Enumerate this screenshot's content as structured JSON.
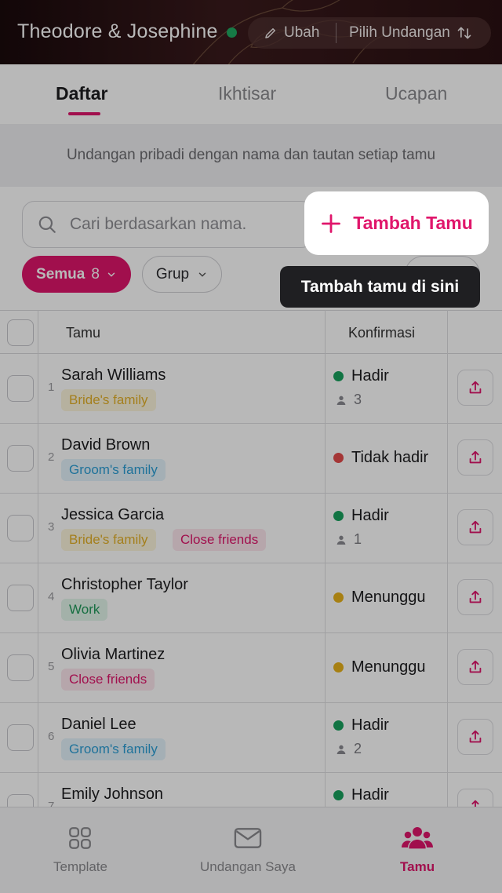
{
  "header": {
    "couple_name": "Theodore & Josephine",
    "edit_label": "Ubah",
    "choose_label": "Pilih Undangan"
  },
  "tabs": [
    {
      "label": "Daftar",
      "active": true
    },
    {
      "label": "Ikhtisar",
      "active": false
    },
    {
      "label": "Ucapan",
      "active": false
    }
  ],
  "info_text": "Undangan pribadi dengan nama dan tautan setiap tamu",
  "search": {
    "placeholder": "Cari berdasarkan nama."
  },
  "add_button": {
    "label": "Tambah Tamu"
  },
  "tooltip": "Tambah tamu di sini",
  "filters": {
    "all_label": "Semua",
    "all_count": "8",
    "group_label": "Grup"
  },
  "table": {
    "headers": {
      "guest": "Tamu",
      "confirm": "Konfirmasi"
    },
    "rows": [
      {
        "num": "1",
        "name": "Sarah Williams",
        "tags": [
          "Bride's family"
        ],
        "status": "Hadir",
        "status_color": "#18a15e",
        "people": "3"
      },
      {
        "num": "2",
        "name": "David Brown",
        "tags": [
          "Groom's family"
        ],
        "status": "Tidak hadir",
        "status_color": "#e44b4b",
        "people": ""
      },
      {
        "num": "3",
        "name": "Jessica Garcia",
        "tags": [
          "Bride's family",
          "Close friends"
        ],
        "status": "Hadir",
        "status_color": "#18a15e",
        "people": "1"
      },
      {
        "num": "4",
        "name": "Christopher Taylor",
        "tags": [
          "Work"
        ],
        "status": "Menunggu",
        "status_color": "#e8b21b",
        "people": ""
      },
      {
        "num": "5",
        "name": "Olivia Martinez",
        "tags": [
          "Close friends"
        ],
        "status": "Menunggu",
        "status_color": "#e8b21b",
        "people": ""
      },
      {
        "num": "6",
        "name": "Daniel Lee",
        "tags": [
          "Groom's family"
        ],
        "status": "Hadir",
        "status_color": "#18a15e",
        "people": "2"
      },
      {
        "num": "7",
        "name": "Emily Johnson",
        "tags": [],
        "status": "Hadir",
        "status_color": "#18a15e",
        "people": ""
      }
    ]
  },
  "bottom_nav": [
    {
      "label": "Template",
      "icon": "grid-icon"
    },
    {
      "label": "Undangan Saya",
      "icon": "envelope-icon"
    },
    {
      "label": "Tamu",
      "icon": "users-icon",
      "active": true
    }
  ],
  "colors": {
    "accent": "#e0166b",
    "header_bg": "#2a1012"
  }
}
